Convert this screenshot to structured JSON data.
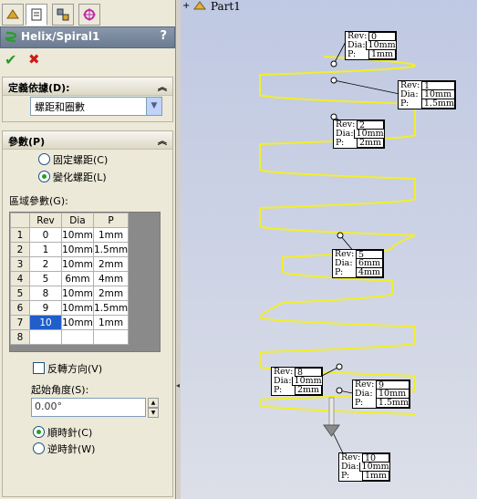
{
  "window": {
    "tree_root": "Part1"
  },
  "panel": {
    "title": "Helix/Spiral1",
    "help_glyph": "?",
    "ok_glyph": "✔",
    "cancel_glyph": "✖",
    "define_by": {
      "header": "定義依據(D):",
      "selected": "螺距和圈數"
    },
    "params": {
      "header": "參數(P)",
      "radio_constant": "固定螺距(C)",
      "radio_variable": "變化螺距(L)",
      "region_label": "區域參數(G):",
      "columns": [
        "Rev",
        "Dia",
        "P"
      ],
      "rows": [
        {
          "n": "1",
          "rev": "0",
          "dia": "10mm",
          "p": "1mm"
        },
        {
          "n": "2",
          "rev": "1",
          "dia": "10mm",
          "p": "1.5mm"
        },
        {
          "n": "3",
          "rev": "2",
          "dia": "10mm",
          "p": "2mm"
        },
        {
          "n": "4",
          "rev": "5",
          "dia": "6mm",
          "p": "4mm"
        },
        {
          "n": "5",
          "rev": "8",
          "dia": "10mm",
          "p": "2mm"
        },
        {
          "n": "6",
          "rev": "9",
          "dia": "10mm",
          "p": "1.5mm"
        },
        {
          "n": "7",
          "rev": "10",
          "dia": "10mm",
          "p": "1mm"
        },
        {
          "n": "8",
          "rev": "",
          "dia": "",
          "p": ""
        }
      ],
      "reverse_label": "反轉方向(V)",
      "start_angle_label": "起始角度(S):",
      "start_angle_value": "0.00°",
      "cw_label": "順時針(C)",
      "ccw_label": "逆時針(W)"
    }
  },
  "callouts": [
    {
      "rev": "0",
      "dia": "10mm",
      "p": "1mm"
    },
    {
      "rev": "1",
      "dia": "10mm",
      "p": "1.5mm"
    },
    {
      "rev": "2",
      "dia": "10mm",
      "p": "2mm"
    },
    {
      "rev": "5",
      "dia": "6mm",
      "p": "4mm"
    },
    {
      "rev": "8",
      "dia": "10mm",
      "p": "2mm"
    },
    {
      "rev": "9",
      "dia": "10mm",
      "p": "1.5mm"
    },
    {
      "rev": "10",
      "dia": "10mm",
      "p": "1mm"
    }
  ],
  "callout_keys": {
    "rev": "Rev:",
    "dia": "Dia:",
    "p": "P:"
  },
  "colors": {
    "helix": "#f2ee2a",
    "accent": "#1f5ecb"
  }
}
